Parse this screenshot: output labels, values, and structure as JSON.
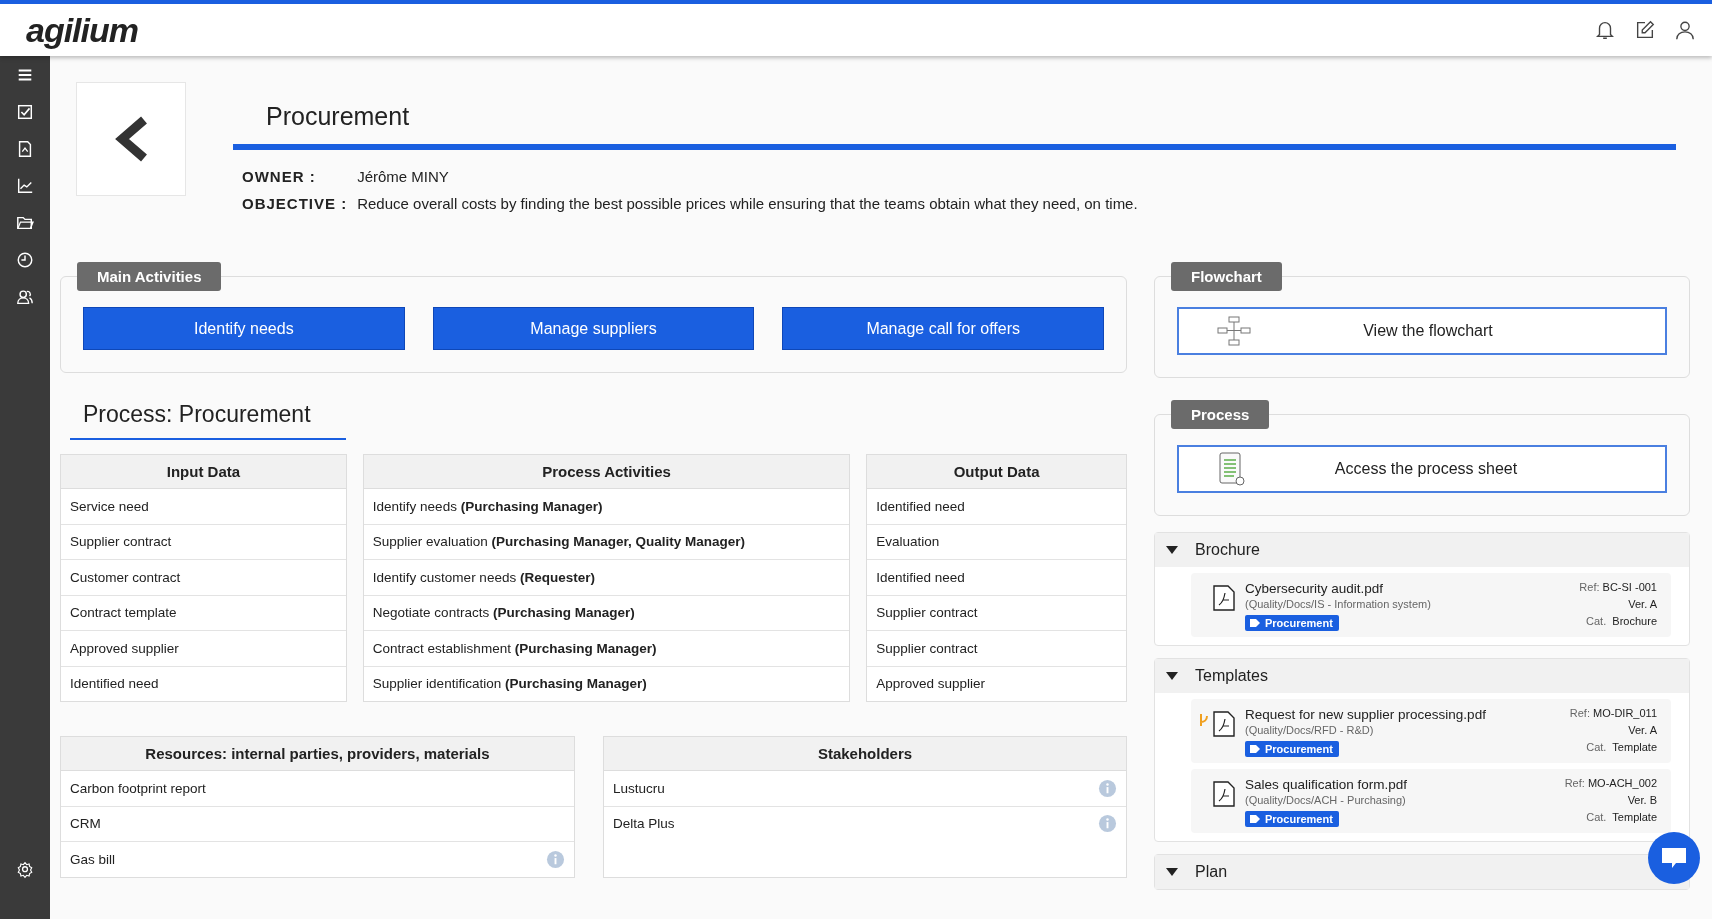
{
  "header": {
    "logo": "agilium"
  },
  "sidebar": {
    "items": [
      {
        "kind": "menu"
      },
      {
        "kind": "tasks"
      },
      {
        "kind": "document"
      },
      {
        "kind": "chart"
      },
      {
        "kind": "folder"
      },
      {
        "kind": "clock"
      },
      {
        "kind": "people"
      }
    ],
    "bottom": {
      "kind": "settings"
    }
  },
  "page": {
    "title": "Procurement",
    "owner_label": "OWNER :",
    "owner": "Jérôme MINY",
    "objective_label": "OBJECTIVE :",
    "objective": "Reduce overall costs by finding the best possible prices while ensuring that the teams obtain what they need, on time."
  },
  "main_activities": {
    "title": "Main Activities",
    "buttons": [
      "Identify needs",
      "Manage suppliers",
      "Manage call for offers"
    ]
  },
  "process": {
    "title": "Process: Procurement",
    "tables": [
      {
        "heading": "Input Data",
        "rows": [
          "Service need",
          "Supplier contract",
          "Customer contract",
          "Contract template",
          "Approved supplier",
          "Identified need"
        ]
      },
      {
        "heading": "Process Activities",
        "rows": [
          "Identify needs **(Purchasing Manager)**",
          "Supplier evaluation **(Purchasing Manager, Quality Manager)**",
          "Identify customer needs **(Requester)**",
          "Negotiate contracts **(Purchasing Manager)**",
          "Contract establishment **(Purchasing Manager)**",
          "Supplier identification **(Purchasing Manager)**"
        ]
      },
      {
        "heading": "Output Data",
        "rows": [
          "Identified need",
          "Evaluation",
          "Identified need",
          "Supplier contract",
          "Supplier contract",
          "Approved supplier"
        ]
      }
    ]
  },
  "resources": {
    "heading": "Resources: internal parties, providers, materials",
    "rows": [
      {
        "label": "Carbon footprint report",
        "info": false
      },
      {
        "label": "CRM",
        "info": false
      },
      {
        "label": "Gas bill",
        "info": true
      }
    ]
  },
  "stakeholders": {
    "heading": "Stakeholders",
    "rows": [
      {
        "label": "Lustucru",
        "info": true
      },
      {
        "label": "Delta Plus",
        "info": true
      }
    ]
  },
  "flowchart": {
    "title": "Flowchart",
    "button": "View the flowchart"
  },
  "process_sheet": {
    "title": "Process",
    "button": "Access the process sheet"
  },
  "sections": [
    {
      "title": "Brochure",
      "expanded": true,
      "documents": [
        {
          "name": "Cybersecurity audit.pdf",
          "path": "(Quality/Docs/IS - Information system)",
          "tag": "Procurement",
          "flagged": false,
          "ref_label": "Ref:",
          "ref": "BC-SI -001",
          "version": "Ver. A",
          "cat_label": "Cat.",
          "cat": "Brochure"
        }
      ]
    },
    {
      "title": "Templates",
      "expanded": true,
      "documents": [
        {
          "name": "Request for new supplier processing.pdf",
          "path": "(Quality/Docs/RFD - R&D)",
          "tag": "Procurement",
          "flagged": true,
          "ref_label": "Ref:",
          "ref": "MO-DIR_011",
          "version": "Ver. A",
          "cat_label": "Cat.",
          "cat": "Template"
        },
        {
          "name": "Sales qualification form.pdf",
          "path": "(Quality/Docs/ACH - Purchasing)",
          "tag": "Procurement",
          "flagged": false,
          "ref_label": "Ref:",
          "ref": "MO-ACH_002",
          "version": "Ver. B",
          "cat_label": "Cat.",
          "cat": "Template"
        }
      ]
    },
    {
      "title": "Plan",
      "expanded": true
    }
  ]
}
